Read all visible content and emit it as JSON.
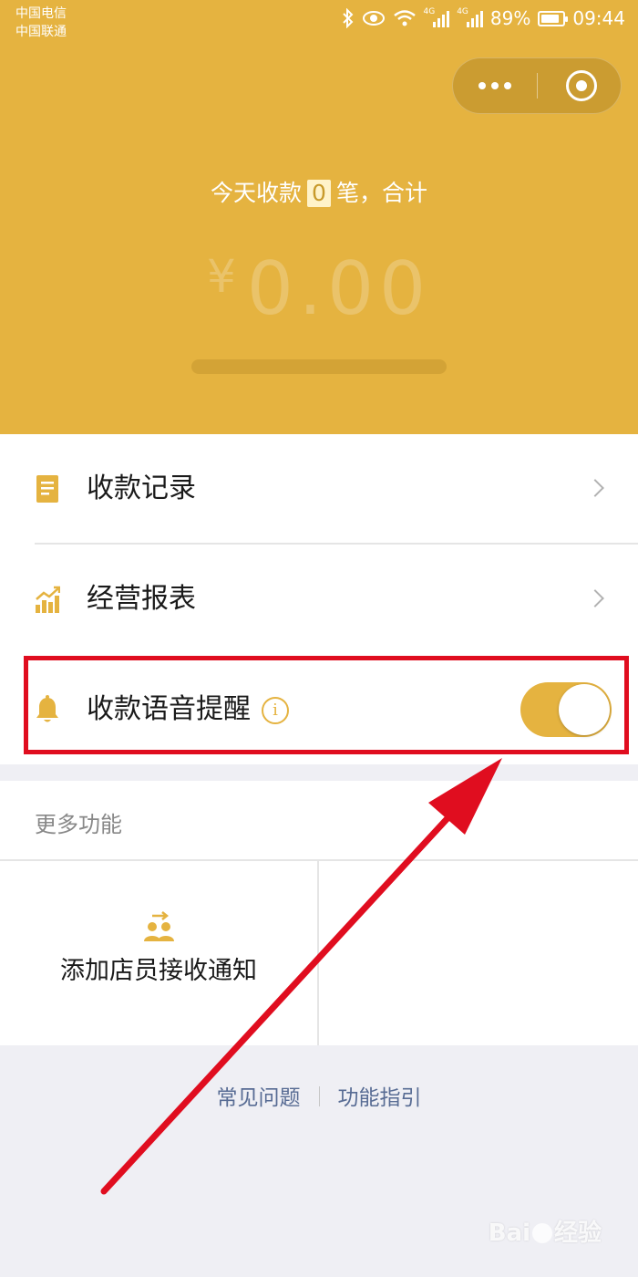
{
  "status_bar": {
    "carrier_1": "中国电信",
    "carrier_2": "中国联通",
    "network_1": "4G",
    "network_2": "4G",
    "battery": "89%",
    "time": "09:44"
  },
  "header": {
    "today_prefix": "今天收款",
    "today_count": "0",
    "today_suffix": "笔，合计",
    "currency": "¥",
    "amount": "0.00"
  },
  "menu": {
    "records_label": "收款记录",
    "reports_label": "经营报表",
    "voice_label": "收款语音提醒",
    "info_symbol": "i",
    "voice_toggle_on": true
  },
  "more": {
    "title": "更多功能",
    "add_staff_label": "添加店员接收通知"
  },
  "footer": {
    "faq": "常见问题",
    "guide": "功能指引"
  },
  "watermark": {
    "text_1": "Bai",
    "text_2": "经验"
  },
  "colors": {
    "brand": "#e5b340",
    "highlight": "#e00d1f"
  }
}
